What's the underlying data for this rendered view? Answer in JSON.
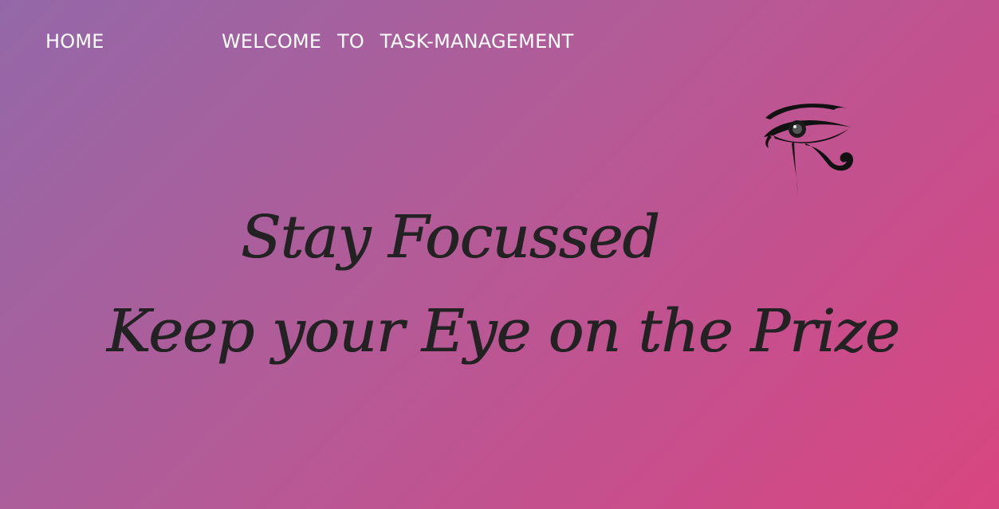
{
  "nav": {
    "home_label": "HOME",
    "title": "WELCOME TO TASK-MANAGEMENT"
  },
  "logo": {
    "icon": "eye-of-ra-icon"
  },
  "hero": {
    "line1": "Stay Focussed",
    "line2": "Keep your Eye on the Prize"
  },
  "colors": {
    "gradient_start": "#9468a8",
    "gradient_end": "#d8467f",
    "nav_text": "#ffffff",
    "tagline_text": "#222222"
  }
}
